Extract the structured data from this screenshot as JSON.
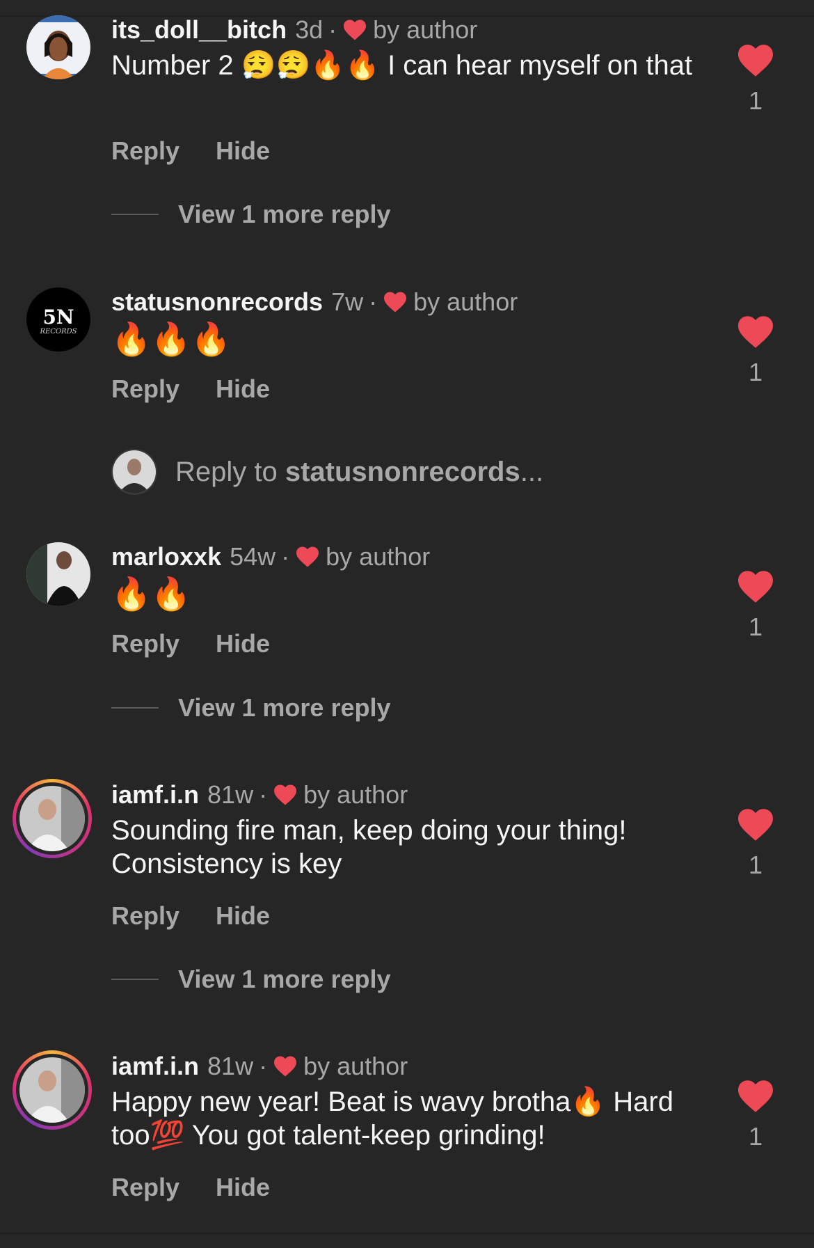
{
  "colors": {
    "background": "#262626",
    "text": "#f5f5f5",
    "muted": "#a8a8a8",
    "heart": "#ed4956"
  },
  "comments": [
    {
      "username": "its_doll__bitch",
      "time": "3d",
      "by_author": "by author",
      "text": "Number 2 😮‍💨😮‍💨🔥🔥 I can hear myself on that",
      "reply_label": "Reply",
      "hide_label": "Hide",
      "like_count": "1",
      "view_more": "View 1 more reply"
    },
    {
      "username": "statusnonrecords",
      "time": "7w",
      "by_author": "by author",
      "text": "🔥🔥🔥",
      "reply_label": "Reply",
      "hide_label": "Hide",
      "like_count": "1",
      "avatar_logo": "5N",
      "avatar_sub": "RECORDS"
    },
    {
      "username": "marloxxk",
      "time": "54w",
      "by_author": "by author",
      "text": "🔥🔥",
      "reply_label": "Reply",
      "hide_label": "Hide",
      "like_count": "1",
      "view_more": "View 1 more reply"
    },
    {
      "username": "iamf.i.n",
      "time": "81w",
      "by_author": "by author",
      "text": "Sounding fire man, keep doing your thing! Consistency is key",
      "reply_label": "Reply",
      "hide_label": "Hide",
      "like_count": "1",
      "view_more": "View 1 more reply"
    },
    {
      "username": "iamf.i.n",
      "time": "81w",
      "by_author": "by author",
      "text": "Happy new year! Beat is wavy brotha🔥 Hard too💯 You got talent-keep grinding!",
      "reply_label": "Reply",
      "hide_label": "Hide",
      "like_count": "1"
    }
  ],
  "reply_compose": {
    "prefix": "Reply to ",
    "handle": "statusnonrecords",
    "suffix": "..."
  },
  "icons": {
    "like": "heart-icon",
    "author_like": "heart-icon"
  }
}
